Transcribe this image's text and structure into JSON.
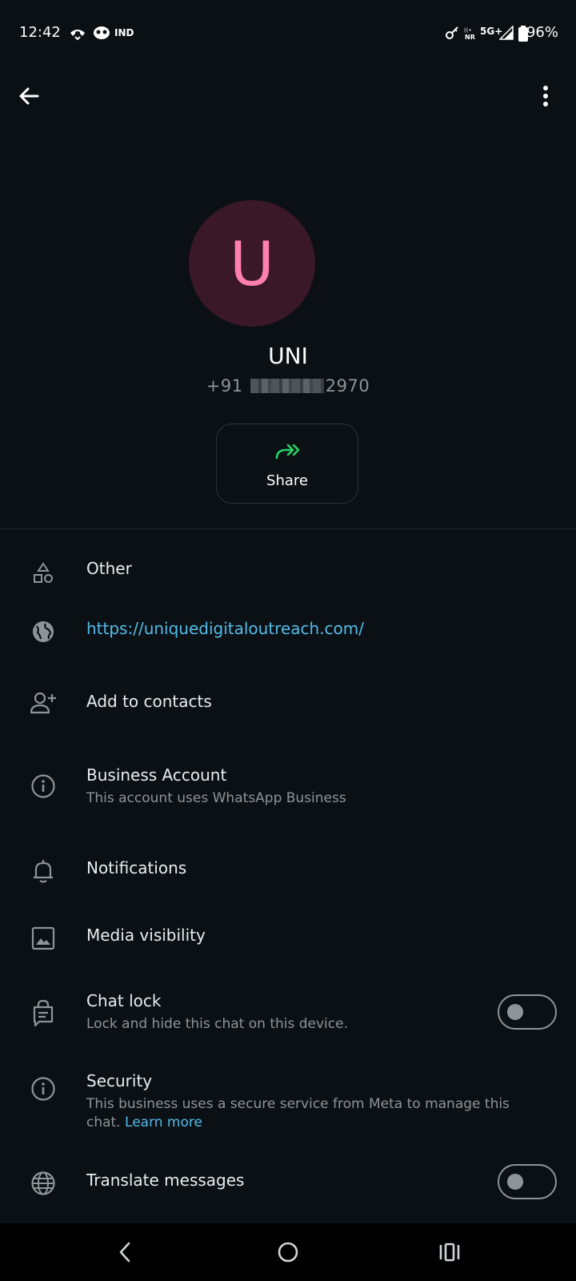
{
  "status_bar": {
    "time": "12:42",
    "carrier_tag": "IND",
    "network": "5G+",
    "battery": "96%"
  },
  "contact": {
    "avatar_letter": "U",
    "name": "UNI",
    "phone_prefix": "+91",
    "phone_suffix": "2970"
  },
  "share": {
    "label": "Share"
  },
  "rows": {
    "other": {
      "title": "Other",
      "icon": "shapes-icon"
    },
    "website": {
      "title": "https://uniquedigitaloutreach.com/",
      "icon": "globe-icon"
    },
    "add_contacts": {
      "title": "Add to contacts",
      "icon": "add-person-icon"
    },
    "business": {
      "title": "Business Account",
      "subtitle": "This account uses WhatsApp Business",
      "icon": "info-icon"
    },
    "notifications": {
      "title": "Notifications",
      "icon": "bell-icon"
    },
    "media": {
      "title": "Media visibility",
      "icon": "image-icon"
    },
    "chat_lock": {
      "title": "Chat lock",
      "subtitle": "Lock and hide this chat on this device.",
      "icon": "chat-lock-icon",
      "enabled": false
    },
    "security": {
      "title": "Security",
      "subtitle": "This business uses a secure service from Meta to manage this chat.",
      "link": "Learn more",
      "icon": "info-icon"
    },
    "translate": {
      "title": "Translate messages",
      "icon": "globe-grid-icon",
      "enabled": false
    }
  },
  "colors": {
    "background": "#0b1014",
    "accent_green": "#25d366",
    "link_blue": "#53bdeb",
    "avatar_bg": "#3a1828",
    "avatar_fg": "#ff80b0"
  }
}
